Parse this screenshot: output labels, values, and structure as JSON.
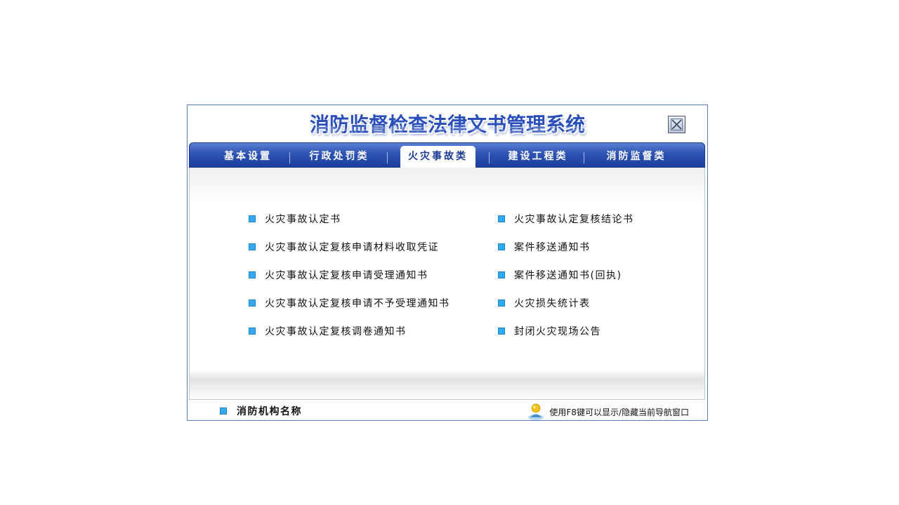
{
  "window": {
    "title": "消防监督检查法律文书管理系统",
    "close_label": "Close"
  },
  "tabs": [
    {
      "label": "基本设置",
      "active": false
    },
    {
      "label": "行政处罚类",
      "active": false
    },
    {
      "label": "火灾事故类",
      "active": true
    },
    {
      "label": "建设工程类",
      "active": false
    },
    {
      "label": "消防监督类",
      "active": false
    }
  ],
  "menu": {
    "left": [
      "火灾事故认定书",
      "火灾事故认定复核申请材料收取凭证",
      "火灾事故认定复核申请受理通知书",
      "火灾事故认定复核申请不予受理通知书",
      "火灾事故认定复核调卷通知书"
    ],
    "right": [
      "火灾事故认定复核结论书",
      "案件移送通知书",
      "案件移送通知书(回执)",
      "火灾损失统计表",
      "封闭火灾现场公告"
    ]
  },
  "footer": {
    "org_label": "消防机构名称",
    "hint": "使用F8键可以显示/隐藏当前导航窗口"
  },
  "colors": {
    "accent": "#2d52b3",
    "bullet": "#33a9ef"
  },
  "icons": {
    "close": "close-x-icon",
    "bullet": "square-bullet-icon",
    "hint": "person-icon"
  }
}
